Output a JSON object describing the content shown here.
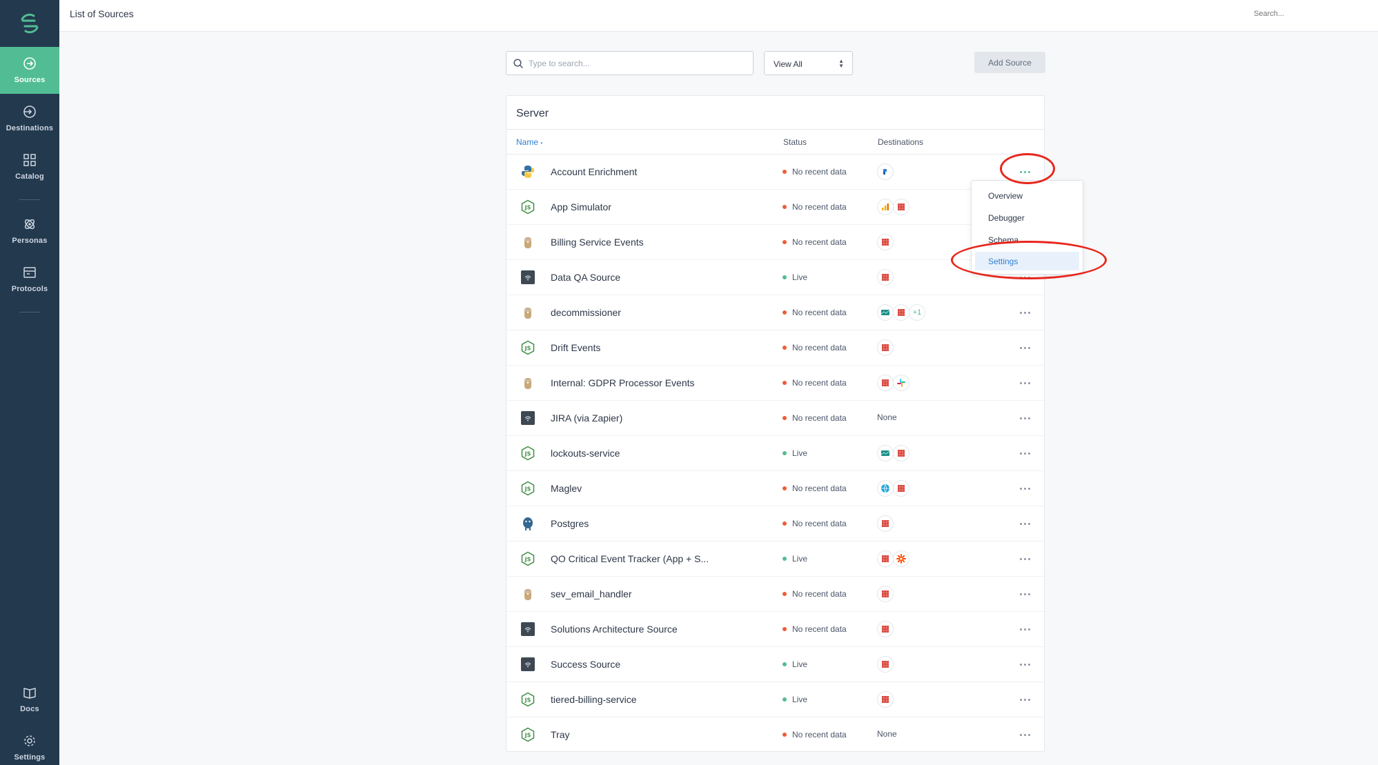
{
  "header": {
    "title": "List of Sources",
    "search_placeholder": "Search..."
  },
  "sidebar": {
    "items": [
      {
        "label": "Sources",
        "icon": "sources-icon",
        "active": true
      },
      {
        "label": "Destinations",
        "icon": "destinations-icon"
      },
      {
        "label": "Catalog",
        "icon": "catalog-icon"
      },
      {
        "label": "Personas",
        "icon": "personas-icon"
      },
      {
        "label": "Protocols",
        "icon": "protocols-icon"
      }
    ],
    "bottom": [
      {
        "label": "Docs",
        "icon": "book-icon"
      },
      {
        "label": "Settings",
        "icon": "gear-icon"
      }
    ]
  },
  "toolbar": {
    "search_placeholder": "Type to search...",
    "view_select": "View All",
    "add_button": "Add Source"
  },
  "card": {
    "title": "Server",
    "columns": {
      "name": "Name",
      "status": "Status",
      "destinations": "Destinations"
    },
    "rows": [
      {
        "name": "Account Enrichment",
        "icon": "python-icon",
        "status": "No recent data",
        "destinations": [
          "blue-icon"
        ],
        "menu_active": true
      },
      {
        "name": "App Simulator",
        "icon": "nodejs-icon",
        "status": "No recent data",
        "destinations": [
          "bars-icon",
          "redshift-icon"
        ]
      },
      {
        "name": "Billing Service Events",
        "icon": "gopher-icon",
        "status": "No recent data",
        "destinations": [
          "redshift-icon"
        ]
      },
      {
        "name": "Data QA Source",
        "icon": "http-icon",
        "status": "Live",
        "destinations": [
          "redshift-icon"
        ]
      },
      {
        "name": "decommissioner",
        "icon": "gopher-icon",
        "status": "No recent data",
        "destinations": [
          "teal-icon",
          "redshift-icon"
        ],
        "more": "+1"
      },
      {
        "name": "Drift Events",
        "icon": "nodejs-icon",
        "status": "No recent data",
        "destinations": [
          "redshift-icon"
        ]
      },
      {
        "name": "Internal: GDPR Processor Events",
        "icon": "gopher-icon",
        "status": "No recent data",
        "destinations": [
          "redshift-icon",
          "slack-icon"
        ]
      },
      {
        "name": "JIRA (via Zapier)",
        "icon": "http-icon",
        "status": "No recent data",
        "destinations": [],
        "none_label": "None"
      },
      {
        "name": "lockouts-service",
        "icon": "nodejs-icon",
        "status": "Live",
        "destinations": [
          "teal-icon",
          "redshift-icon"
        ]
      },
      {
        "name": "Maglev",
        "icon": "nodejs-icon",
        "status": "No recent data",
        "destinations": [
          "globe-icon",
          "redshift-icon"
        ]
      },
      {
        "name": "Postgres",
        "icon": "postgres-icon",
        "status": "No recent data",
        "destinations": [
          "redshift-icon"
        ]
      },
      {
        "name": "QO Critical Event Tracker (App + S...",
        "icon": "nodejs-icon",
        "status": "Live",
        "destinations": [
          "redshift-icon",
          "zapier-icon"
        ]
      },
      {
        "name": "sev_email_handler",
        "icon": "gopher-icon",
        "status": "No recent data",
        "destinations": [
          "redshift-icon"
        ]
      },
      {
        "name": "Solutions Architecture Source",
        "icon": "http-icon",
        "status": "No recent data",
        "destinations": [
          "redshift-icon"
        ]
      },
      {
        "name": "Success Source",
        "icon": "http-icon",
        "status": "Live",
        "destinations": [
          "redshift-icon"
        ]
      },
      {
        "name": "tiered-billing-service",
        "icon": "nodejs-icon",
        "status": "Live",
        "destinations": [
          "redshift-icon"
        ]
      },
      {
        "name": "Tray",
        "icon": "nodejs-icon",
        "status": "No recent data",
        "destinations": [],
        "none_label": "None"
      }
    ]
  },
  "dropdown": {
    "items": [
      "Overview",
      "Debugger",
      "Schema",
      "Settings"
    ],
    "highlighted": "Settings"
  },
  "colors": {
    "sidebar": "#23394e",
    "accent": "#52bd94",
    "link": "#2f80d1",
    "live": "#52bd94",
    "stale": "#ef5b3a",
    "annotation": "#e8261c"
  }
}
